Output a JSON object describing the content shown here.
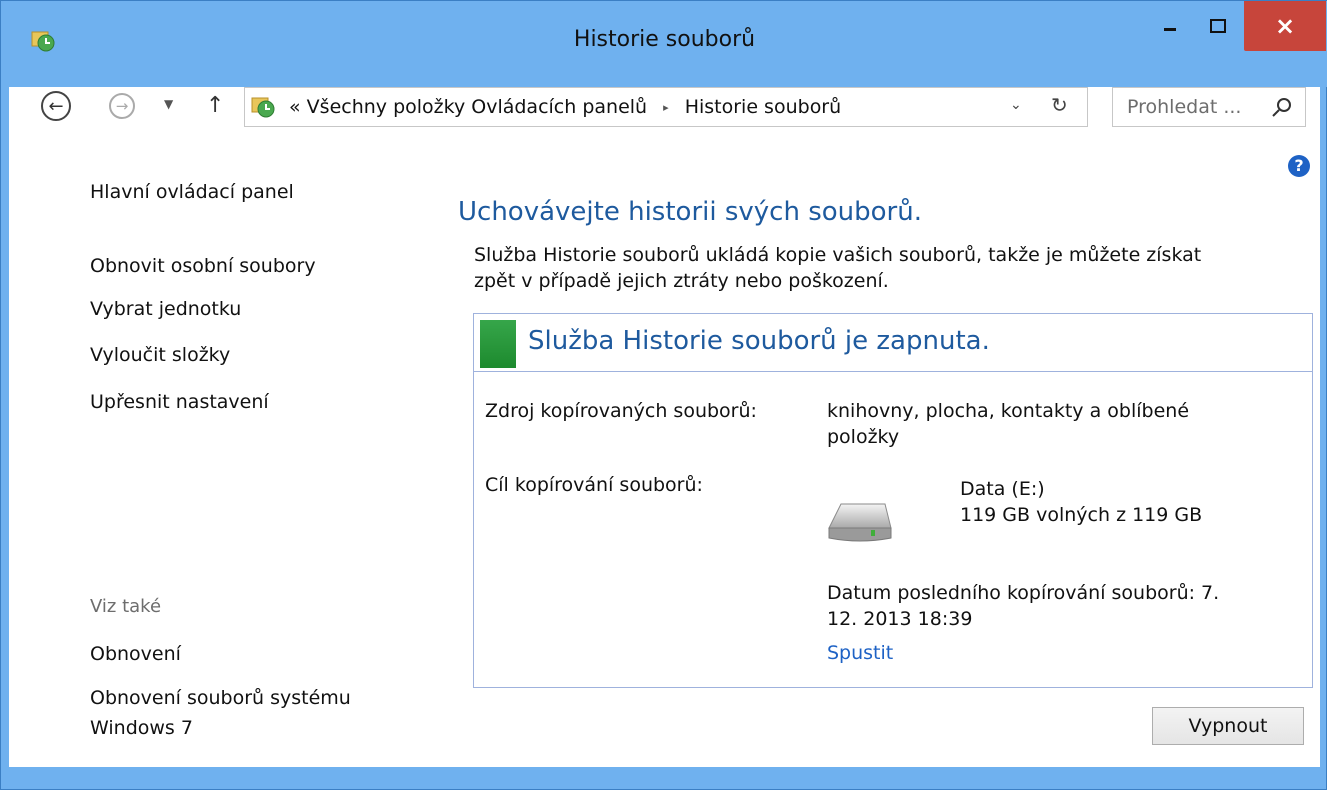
{
  "window": {
    "title": "Historie souborů",
    "minimize_label": "‒",
    "maximize_label": "□",
    "close_label": "×"
  },
  "navigation": {
    "back_icon": "back-arrow-icon",
    "forward_icon": "forward-arrow-icon",
    "recent_icon": "chevron-down-icon",
    "up_icon": "up-arrow-icon",
    "up_label": "↑",
    "address_prefix": "«",
    "breadcrumb": [
      "Všechny položky Ovládacích panelů",
      "Historie souborů"
    ],
    "breadcrumb_separator": "▸",
    "dropdown_label": "⌄",
    "refresh_label": "↻",
    "search_placeholder": "Prohledat ...",
    "search_icon": "search-icon"
  },
  "help": {
    "label": "?"
  },
  "sidebar": {
    "main_link": "Hlavní ovládací panel",
    "links": [
      "Obnovit osobní soubory",
      "Vybrat jednotku",
      "Vyloučit složky",
      "Upřesnit nastavení"
    ],
    "see_also_heading": "Viz také",
    "see_also_links": [
      "Obnovení",
      "Obnovení souborů systému",
      "Windows 7"
    ]
  },
  "main": {
    "title": "Uchovávejte historii svých souborů.",
    "description_line1": "Služba Historie souborů ukládá kopie vašich souborů, takže je můžete získat",
    "description_line2": "zpět v případě jejich ztráty nebo poškození.",
    "status": {
      "text": "Služba Historie souborů je zapnuta.",
      "color": "#2e9e3f"
    },
    "source_label": "Zdroj kopírovaných souborů:",
    "source_value_line1": "knihovny, plocha, kontakty a oblíbené",
    "source_value_line2": "položky",
    "target_label": "Cíl kopírování souborů:",
    "drive_name": "Data (E:)",
    "drive_space": "119 GB volných z 119 GB",
    "last_copy_line1": "Datum posledního kopírování souborů: 7.",
    "last_copy_line2": "12. 2013 18:39",
    "run_link": "Spustit",
    "off_button": "Vypnout"
  },
  "colors": {
    "title_bar": "#6fb1ef",
    "close_button": "#c7453b",
    "heading_blue": "#1e5a9e",
    "link_blue": "#1e62c5"
  }
}
